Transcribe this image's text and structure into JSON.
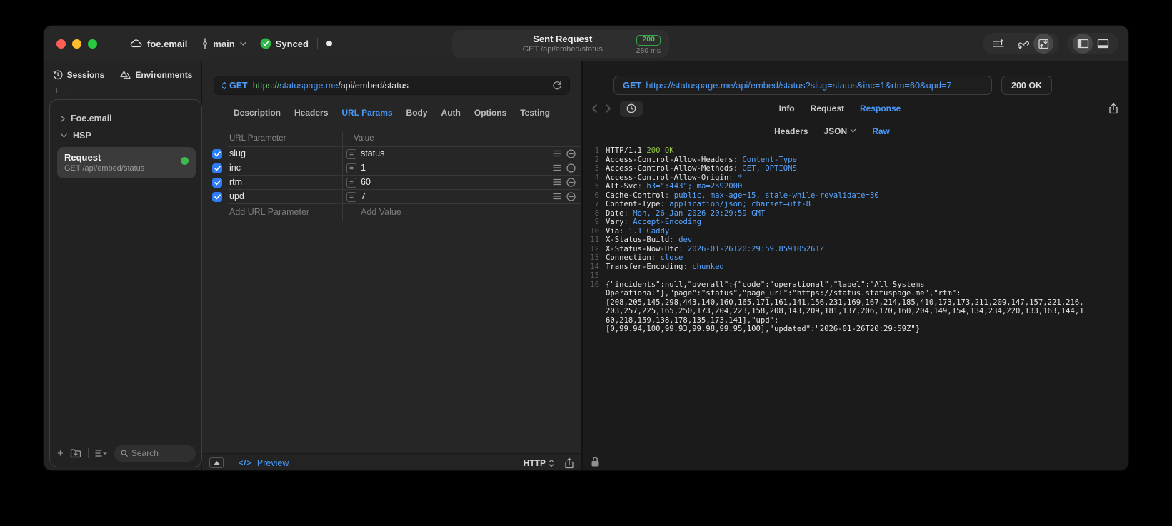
{
  "colors": {
    "accent_blue": "#4799f7",
    "code_blue": "#58a6ff",
    "code_green": "#95c843",
    "status_green": "#45c15a",
    "checkbox_blue": "#2f7cf7"
  },
  "titlebar": {
    "project": "foe.email",
    "branch": "main",
    "sync_status": "Synced",
    "request_summary": {
      "title": "Sent Request",
      "subtitle": "GET /api/embed/status",
      "status_code": "200",
      "duration": "280 ms"
    }
  },
  "sidebar": {
    "tabs": [
      {
        "label": "Sessions"
      },
      {
        "label": "Environments"
      }
    ],
    "tree": [
      {
        "label": "Foe.email"
      },
      {
        "label": "HSP"
      }
    ],
    "request": {
      "title": "Request",
      "subtitle": "GET /api/embed/status"
    },
    "search_placeholder": "Search"
  },
  "request_panel": {
    "method": "GET",
    "url": {
      "scheme": "https://",
      "host": "statuspage.me",
      "path": "/api/embed/status"
    },
    "tabs": [
      "Description",
      "Headers",
      "URL Params",
      "Body",
      "Auth",
      "Options",
      "Testing"
    ],
    "active_tab": "URL Params",
    "params_table": {
      "columns": [
        "URL Parameter",
        "Value"
      ],
      "rows": [
        {
          "name": "slug",
          "value": "status",
          "enabled": true
        },
        {
          "name": "inc",
          "value": "1",
          "enabled": true
        },
        {
          "name": "rtm",
          "value": "60",
          "enabled": true
        },
        {
          "name": "upd",
          "value": "7",
          "enabled": true
        }
      ],
      "add_param_placeholder": "Add URL Parameter",
      "add_value_placeholder": "Add Value"
    },
    "footer": {
      "code_glyph": "</>",
      "preview_label": "Preview",
      "protocol": "HTTP"
    }
  },
  "response_panel": {
    "request_method": "GET",
    "request_url": "https://statuspage.me/api/embed/status?slug=status&inc=1&rtm=60&upd=7",
    "status": "200 OK",
    "tabs": [
      "Info",
      "Request",
      "Response"
    ],
    "active_tab": "Response",
    "subtabs": [
      "Headers",
      "JSON",
      "Raw"
    ],
    "active_subtab": "Raw",
    "code_lines": [
      {
        "n": "1",
        "s": [
          [
            "HTTP/1.1 ",
            "p"
          ],
          [
            "200 OK",
            "g"
          ]
        ]
      },
      {
        "n": "2",
        "s": [
          [
            "Access-Control-Allow-Headers",
            "p"
          ],
          [
            ": ",
            "d"
          ],
          [
            "Content-Type",
            "b"
          ]
        ]
      },
      {
        "n": "3",
        "s": [
          [
            "Access-Control-Allow-Methods",
            "p"
          ],
          [
            ": ",
            "d"
          ],
          [
            "GET, OPTIONS",
            "b"
          ]
        ]
      },
      {
        "n": "4",
        "s": [
          [
            "Access-Control-Allow-Origin",
            "p"
          ],
          [
            ": ",
            "d"
          ],
          [
            "*",
            "b"
          ]
        ]
      },
      {
        "n": "5",
        "s": [
          [
            "Alt-Svc",
            "p"
          ],
          [
            ": ",
            "d"
          ],
          [
            "h3=\":443\"; ma=2592000",
            "b"
          ]
        ]
      },
      {
        "n": "6",
        "s": [
          [
            "Cache-Control",
            "p"
          ],
          [
            ": ",
            "d"
          ],
          [
            "public, max-age=15, stale-while-revalidate=30",
            "b"
          ]
        ]
      },
      {
        "n": "7",
        "s": [
          [
            "Content-Type",
            "p"
          ],
          [
            ": ",
            "d"
          ],
          [
            "application/json; charset=utf-8",
            "b"
          ]
        ]
      },
      {
        "n": "8",
        "s": [
          [
            "Date",
            "p"
          ],
          [
            ": ",
            "d"
          ],
          [
            "Mon, 26 Jan 2026 20:29:59 GMT",
            "b"
          ]
        ]
      },
      {
        "n": "9",
        "s": [
          [
            "Vary",
            "p"
          ],
          [
            ": ",
            "d"
          ],
          [
            "Accept-Encoding",
            "b"
          ]
        ]
      },
      {
        "n": "10",
        "s": [
          [
            "Via",
            "p"
          ],
          [
            ": ",
            "d"
          ],
          [
            "1.1 Caddy",
            "b"
          ]
        ]
      },
      {
        "n": "11",
        "s": [
          [
            "X-Status-Build",
            "p"
          ],
          [
            ": ",
            "d"
          ],
          [
            "dev",
            "b"
          ]
        ]
      },
      {
        "n": "12",
        "s": [
          [
            "X-Status-Now-Utc",
            "p"
          ],
          [
            ": ",
            "d"
          ],
          [
            "2026-01-26T20:29:59.859105261Z",
            "b"
          ]
        ]
      },
      {
        "n": "13",
        "s": [
          [
            "Connection",
            "p"
          ],
          [
            ": ",
            "d"
          ],
          [
            "close",
            "b"
          ]
        ]
      },
      {
        "n": "14",
        "s": [
          [
            "Transfer-Encoding",
            "p"
          ],
          [
            ": ",
            "d"
          ],
          [
            "chunked",
            "b"
          ]
        ]
      },
      {
        "n": "15",
        "s": []
      },
      {
        "n": "16",
        "s": [
          [
            "{\"incidents\":null,\"overall\":{\"code\":\"operational\",\"label\":\"All Systems",
            "p"
          ]
        ]
      },
      {
        "n": "",
        "s": [
          [
            "Operational\"},\"page\":\"status\",\"page_url\":\"https://status.statuspage.me\",\"rtm\":",
            "p"
          ]
        ]
      },
      {
        "n": "",
        "s": [
          [
            "[208,205,145,298,443,140,160,165,171,161,141,156,231,169,167,214,185,410,173,173,211,209,147,157,221,216,",
            "p"
          ]
        ]
      },
      {
        "n": "",
        "s": [
          [
            "203,257,225,165,250,173,204,223,158,208,143,209,181,137,206,170,160,204,149,154,134,234,220,133,163,144,1",
            "p"
          ]
        ]
      },
      {
        "n": "",
        "s": [
          [
            "60,218,159,138,178,135,173,141],\"upd\":",
            "p"
          ]
        ]
      },
      {
        "n": "",
        "s": [
          [
            "[0,99.94,100,99.93,99.98,99.95,100],\"updated\":\"2026-01-26T20:29:59Z\"}",
            "p"
          ]
        ]
      }
    ]
  }
}
